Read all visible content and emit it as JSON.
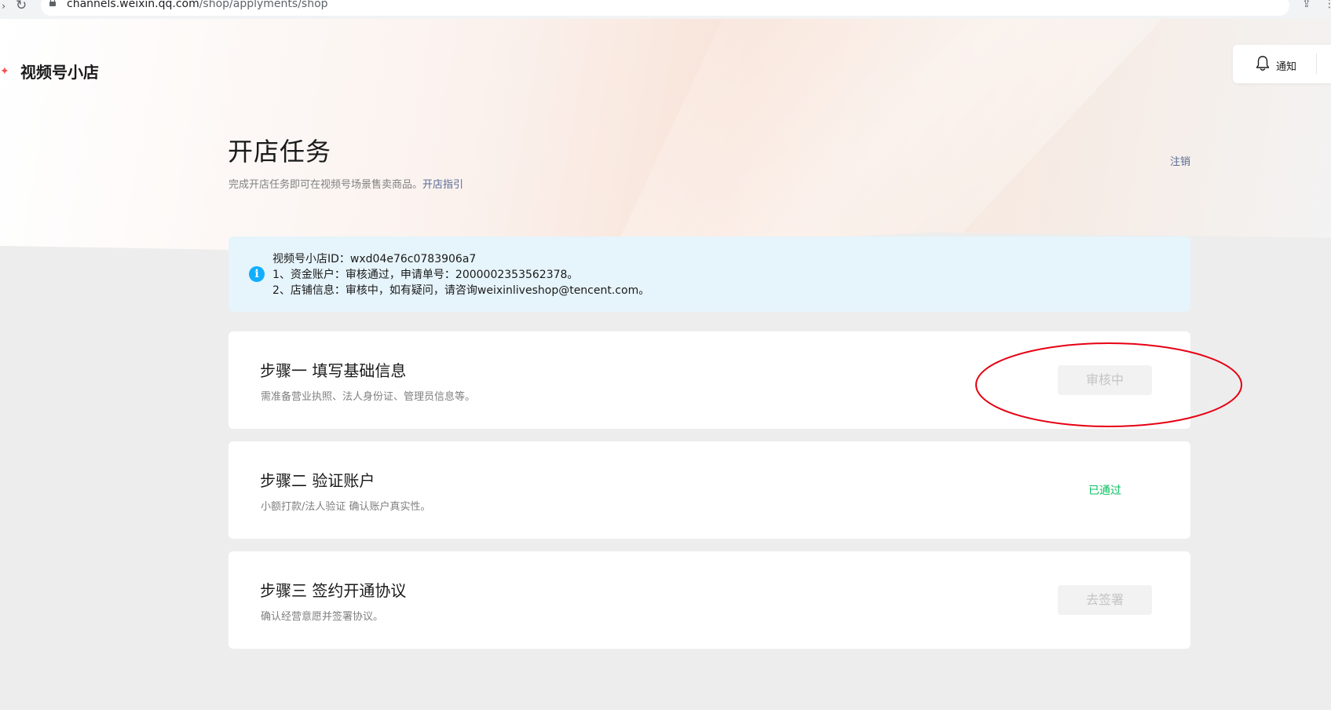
{
  "browser": {
    "url_host": "channels.weixin.qq.com",
    "url_path": "/shop/applyments/shop"
  },
  "header": {
    "brand_name": "视频号小店",
    "notify_label": "通知"
  },
  "page": {
    "title": "开店任务",
    "subtitle": "完成开店任务即可在视频号场景售卖商品。",
    "guide_link": "开店指引",
    "cancel_link": "注销"
  },
  "info_banner": {
    "line1": "视频号小店ID：wxd04e76c0783906a7",
    "line2": "1、资金账户：审核通过，申请单号：2000002353562378。",
    "line3": "2、店铺信息：审核中，如有疑问，请咨询weixinliveshop@tencent.com。"
  },
  "steps": [
    {
      "title": "步骤一 填写基础信息",
      "desc": "需准备营业执照、法人身份证、管理员信息等。",
      "action_label": "审核中"
    },
    {
      "title": "步骤二 验证账户",
      "desc": "小额打款/法人验证 确认账户真实性。",
      "status_label": "已通过"
    },
    {
      "title": "步骤三 签约开通协议",
      "desc": "确认经营意愿并签署协议。",
      "action_label": "去签署"
    }
  ],
  "colors": {
    "link": "#576b95",
    "success": "#07c160",
    "info_bg": "#e6f4fb",
    "info_icon": "#10aeff",
    "annotation": "#e60012"
  }
}
